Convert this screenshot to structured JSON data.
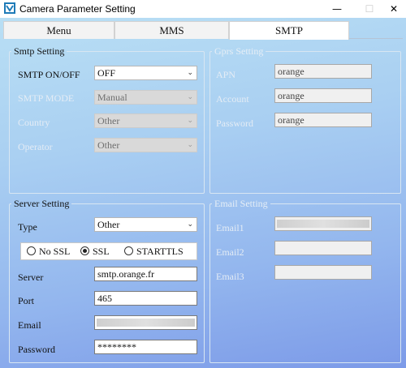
{
  "window": {
    "title": "Camera Parameter Setting",
    "icon": "app-icon",
    "controls": {
      "minimize": "—",
      "maximize": "☐",
      "close": "✕"
    }
  },
  "tabs": [
    {
      "label": "Menu",
      "active": false
    },
    {
      "label": "MMS",
      "active": false
    },
    {
      "label": "SMTP",
      "active": true
    }
  ],
  "smtp_setting": {
    "legend": "Smtp Setting",
    "onoff_label": "SMTP ON/OFF",
    "onoff_value": "OFF",
    "mode_label": "SMTP MODE",
    "mode_value": "Manual",
    "country_label": "Country",
    "country_value": "Other",
    "operator_label": "Operator",
    "operator_value": "Other"
  },
  "gprs_setting": {
    "legend": "Gprs Setting",
    "apn_label": "APN",
    "apn_value": "orange",
    "account_label": "Account",
    "account_value": "orange",
    "password_label": "Password",
    "password_value": "orange"
  },
  "server_setting": {
    "legend": "Server Setting",
    "type_label": "Type",
    "type_value": "Other",
    "ssl_options": [
      {
        "label": "No SSL",
        "selected": false
      },
      {
        "label": "SSL",
        "selected": true
      },
      {
        "label": "STARTTLS",
        "selected": false
      }
    ],
    "server_label": "Server",
    "server_value": "smtp.orange.fr",
    "port_label": "Port",
    "port_value": "465",
    "email_label": "Email",
    "password_label": "Password",
    "password_value": "********"
  },
  "email_setting": {
    "legend": "Email Setting",
    "email1_label": "Email1",
    "email2_label": "Email2",
    "email3_label": "Email3"
  },
  "colors": {
    "background_top": "#b9dff4",
    "background_bottom": "#7c9ae8",
    "disabled_label": "#e4ecf5"
  }
}
